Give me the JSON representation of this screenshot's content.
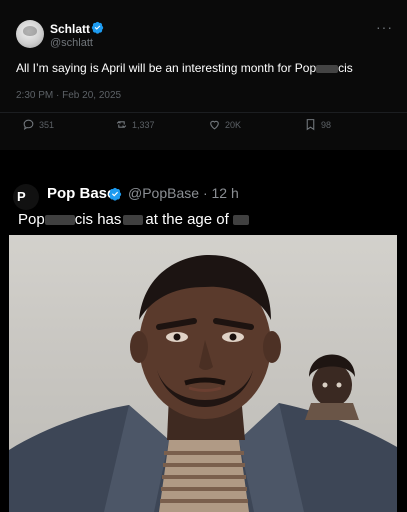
{
  "top_tweet": {
    "author_name": "Schlatt",
    "author_handle": "@schlatt",
    "text_visible": "All I’m saying is April will be an interesting month for Pop",
    "text_suffix": "cis",
    "timestamp": "2:30 PM · Feb 20, 2025",
    "more_icon": "···",
    "actions": {
      "replies": "351",
      "reposts": "1,337",
      "likes": "20K",
      "bookmarks": "98"
    },
    "verified_color": "#1d9bf0"
  },
  "quote_tweet": {
    "author_name": "Pop Base",
    "author_handle": "@PopBase",
    "time_ago": "· 12 h",
    "text_part1": "Pop",
    "text_part2": "cis has",
    "text_part3": "at the age of",
    "verified_color": "#1d9bf0"
  }
}
